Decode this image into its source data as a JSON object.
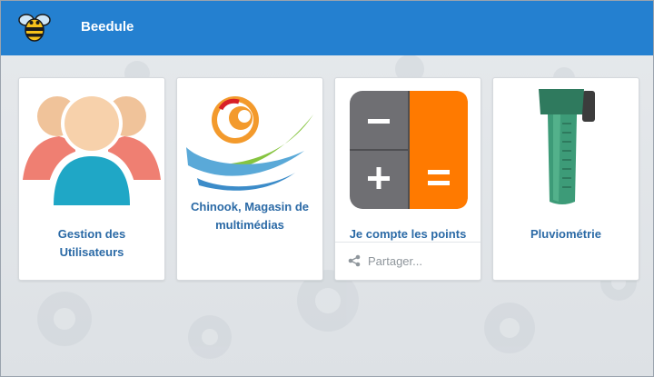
{
  "header": {
    "app_title": "Beedule",
    "logo_icon": "bee-icon",
    "background_color": "#2480d0"
  },
  "cards": [
    {
      "label": "Gestion des Utilisateurs",
      "icon": "users-icon"
    },
    {
      "label": "Chinook, Magasin de multimédias",
      "icon": "chinook-logo-icon"
    },
    {
      "label": "Je compte les points",
      "icon": "calculator-icon",
      "share_label": "Partager..."
    },
    {
      "label": "Pluviométrie",
      "icon": "rain-gauge-icon"
    }
  ],
  "colors": {
    "label": "#2b6aa6",
    "calc_dark": "#6f6f73",
    "calc_orange": "#ff7a00"
  }
}
